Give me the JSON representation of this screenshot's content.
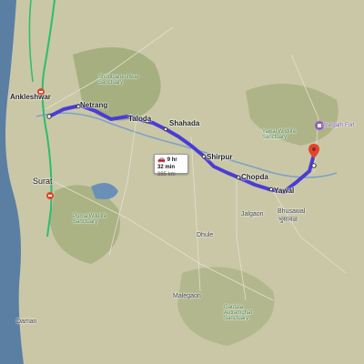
{
  "map": {
    "route": {
      "color": "#4b3bd6",
      "duration": "9 hr 32 min",
      "distance": "385 km",
      "vehicle_icon": "car-icon"
    },
    "places": {
      "ankleshwar": "Ankleshwar",
      "netrang": "Netrang",
      "taloda": "Taloda",
      "shahada": "Shahada",
      "shirpur": "Shirpur",
      "chopda": "Chopda",
      "yawal": "Yawal",
      "surat": "Surat",
      "bhusawal": "Bhusawal",
      "bhusawal_local": "भुसावळ",
      "jalgaon": "Jalgaon",
      "dhule": "Dhule",
      "malegaon": "Malegaon",
      "daman": "Daman",
      "asirgarh_fort": "Asirgarh Fort",
      "shoolpaneshwar": "Shoolpaneshwar Sanctuary",
      "yawal_sanctuary": "Yawal Wildlife Sanctuary",
      "purna_sanctuary": "Purna Wildlife Sanctuary",
      "gautala": "Gautala Autramghat Sanctuary"
    },
    "markers": {
      "origin_color": "#ffffff",
      "destination_color": "#e0452d",
      "highway_color": "#2bbd6e"
    }
  }
}
